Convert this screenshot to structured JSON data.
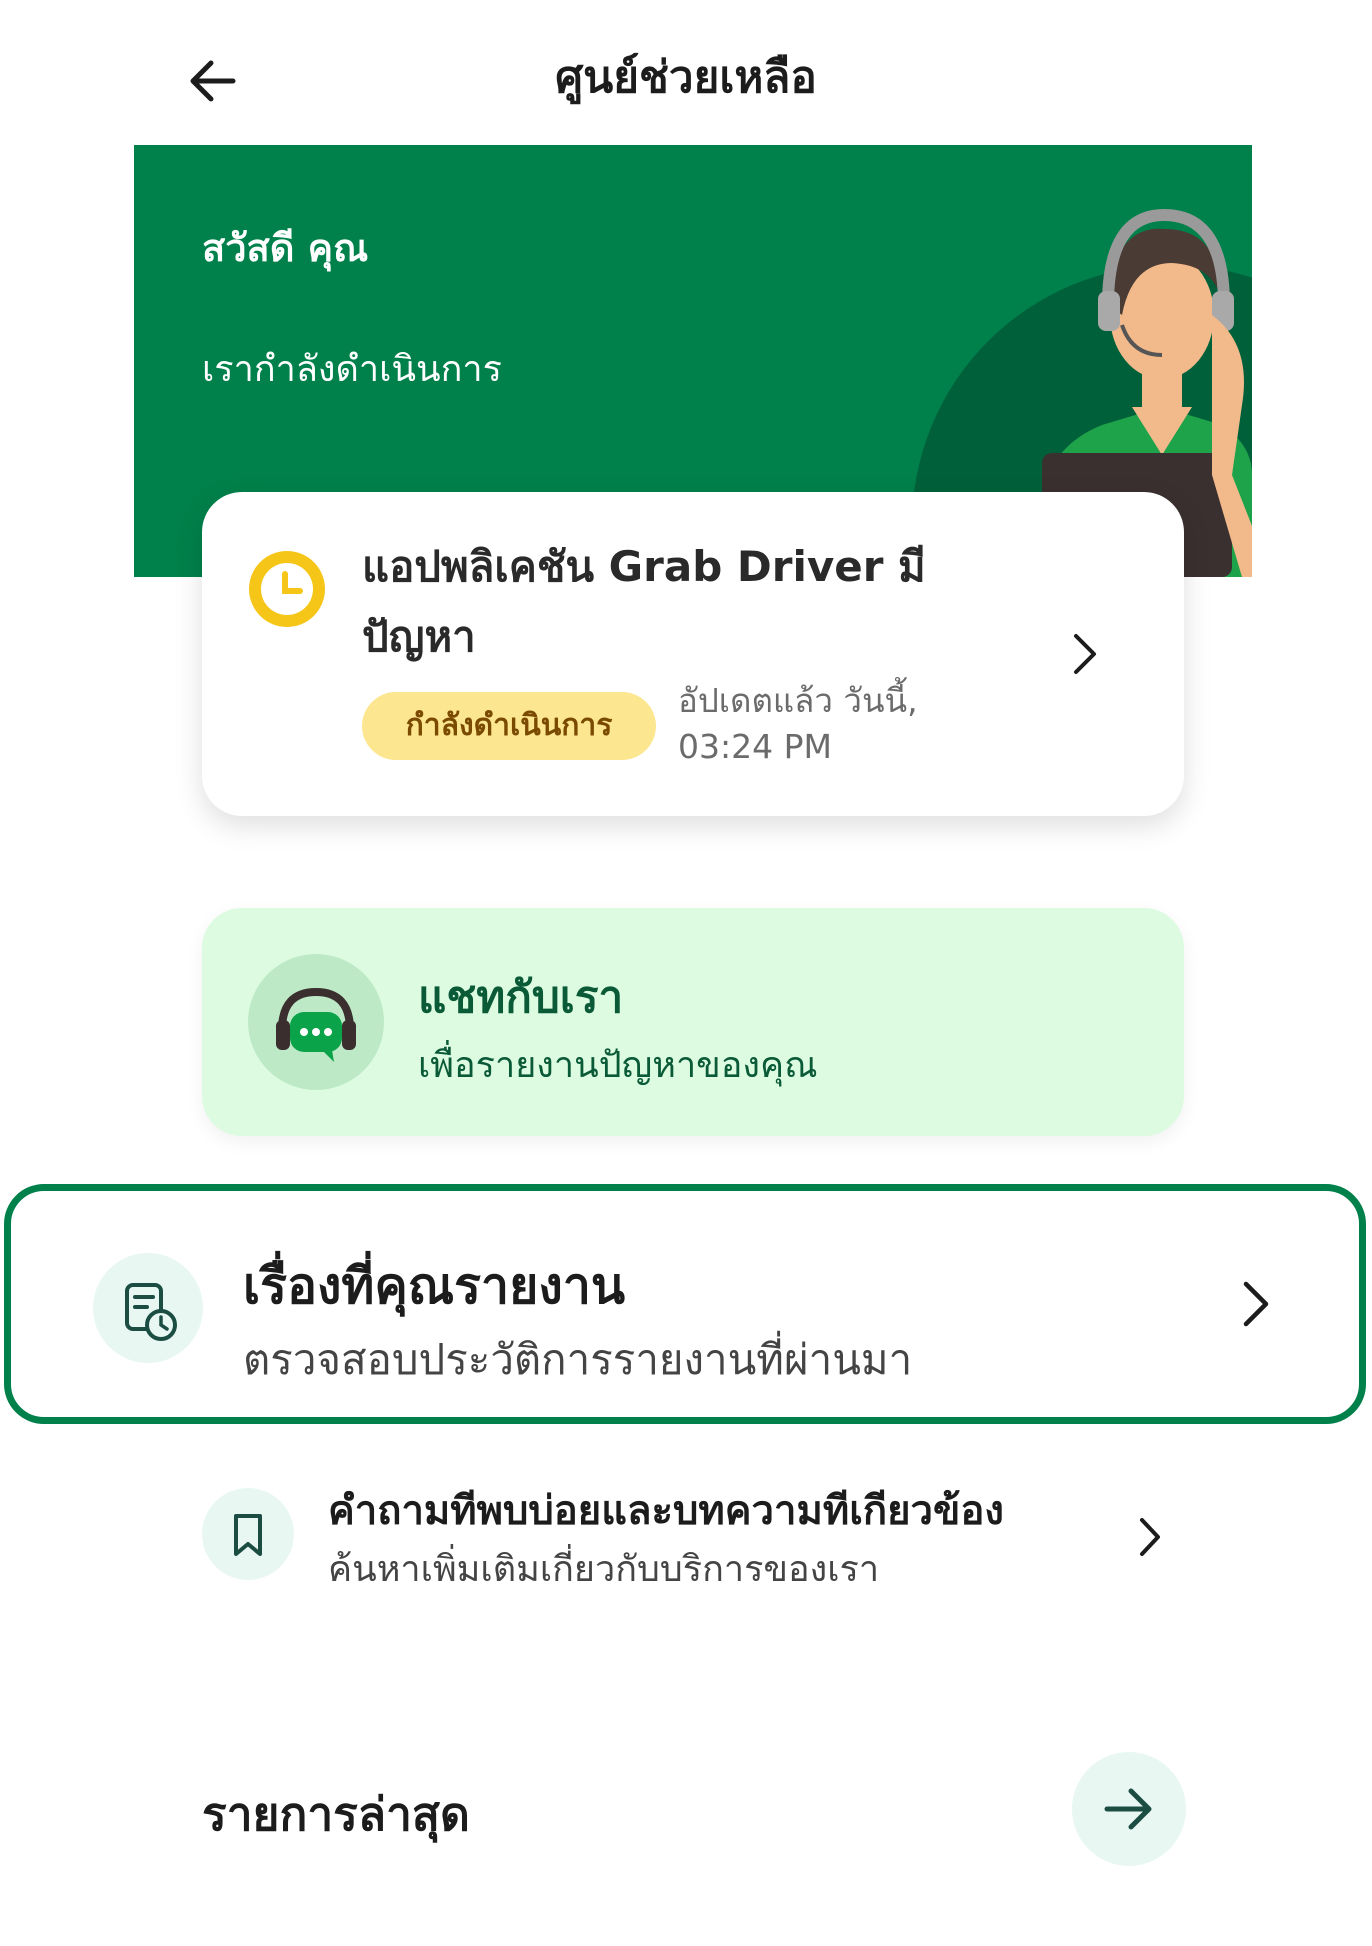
{
  "header": {
    "title": "ศูนย์ช่วยเหลือ",
    "back_icon": "arrow-left-icon"
  },
  "banner": {
    "greeting": "สวัสดี คุณ",
    "status": "เรากำลังดำเนินการ",
    "color": "#00804a"
  },
  "ticket": {
    "title": "แอปพลิเคชัน Grab Driver มีปัญหา",
    "badge": "กำลังดำเนินการ",
    "updated": "อัปเดตแล้ว วันนี้, 03:24 PM",
    "icon": "clock-icon"
  },
  "chat": {
    "title": "แชทกับเรา",
    "subtitle": "เพื่อรายงานปัญหาของคุณ",
    "icon": "headset-chat-icon"
  },
  "reports": {
    "title": "เรื่องที่คุณรายงาน",
    "subtitle": "ตรวจสอบประวัติการรายงานที่ผ่านมา",
    "icon": "report-history-icon"
  },
  "faq": {
    "title": "คำถามทีพบบ่อยและบทความทีเกียวข้อง",
    "subtitle": "ค้นหาเพิ่มเติมเกี่ยวกับบริการของเรา",
    "icon": "bookmark-icon"
  },
  "latest": {
    "title": "รายการล่าสุด",
    "icon": "arrow-right-icon"
  }
}
